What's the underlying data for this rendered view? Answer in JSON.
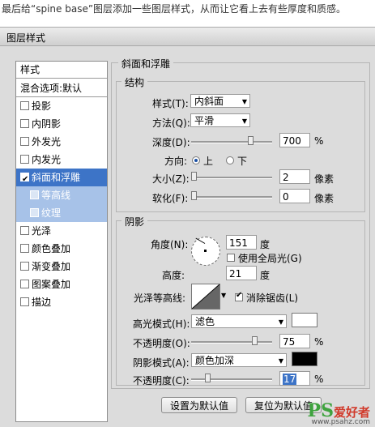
{
  "caption": "最后给“spine base”图层添加一些图层样式，从而让它看上去有些厚度和质感。",
  "window": {
    "title": "图层样式"
  },
  "sidebar": {
    "header": "样式",
    "blend_options": "混合选项:默认",
    "items": [
      {
        "label": "投影",
        "checked": false
      },
      {
        "label": "内阴影",
        "checked": false
      },
      {
        "label": "外发光",
        "checked": false
      },
      {
        "label": "内发光",
        "checked": false
      },
      {
        "label": "斜面和浮雕",
        "checked": true,
        "active": true
      },
      {
        "label": "等高线",
        "checked": false,
        "sub": true
      },
      {
        "label": "纹理",
        "checked": false,
        "sub": true
      },
      {
        "label": "光泽",
        "checked": false
      },
      {
        "label": "颜色叠加",
        "checked": false
      },
      {
        "label": "渐变叠加",
        "checked": false
      },
      {
        "label": "图案叠加",
        "checked": false
      },
      {
        "label": "描边",
        "checked": false
      }
    ]
  },
  "bevel": {
    "title": "斜面和浮雕",
    "structure_title": "结构",
    "style_label": "样式(T):",
    "style_value": "内斜面",
    "technique_label": "方法(Q):",
    "technique_value": "平滑",
    "depth_label": "深度(D):",
    "depth_value": "700",
    "depth_unit": "%",
    "direction_label": "方向:",
    "direction_up": "上",
    "direction_down": "下",
    "size_label": "大小(Z):",
    "size_value": "2",
    "size_unit": "像素",
    "soften_label": "软化(F):",
    "soften_value": "0",
    "soften_unit": "像素"
  },
  "shading": {
    "title": "阴影",
    "angle_label": "角度(N):",
    "angle_value": "151",
    "angle_unit": "度",
    "global_light_label": "使用全局光(G)",
    "altitude_label": "高度:",
    "altitude_value": "21",
    "altitude_unit": "度",
    "gloss_label": "光泽等高线:",
    "antialias_label": "消除锯齿(L)",
    "highlight_mode_label": "高光模式(H):",
    "highlight_mode_value": "滤色",
    "highlight_color": "#ffffff",
    "highlight_opacity_label": "不透明度(O):",
    "highlight_opacity_value": "75",
    "shadow_mode_label": "阴影模式(A):",
    "shadow_mode_value": "颜色加深",
    "shadow_color": "#000000",
    "shadow_opacity_label": "不透明度(C):",
    "shadow_opacity_value": "17",
    "percent": "%"
  },
  "buttons": {
    "make_default": "设置为默认值",
    "reset_default": "复位为默认值"
  },
  "watermark": {
    "ps": "PS",
    "name": "爱好者",
    "url": "www.psahz.com"
  }
}
